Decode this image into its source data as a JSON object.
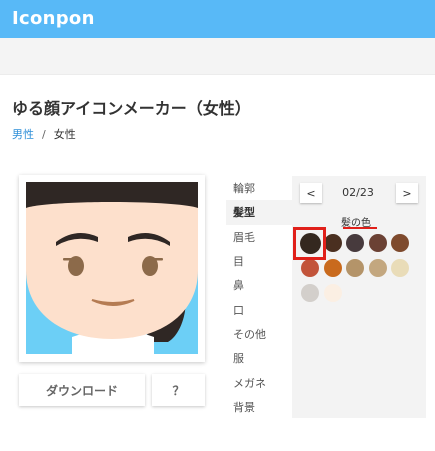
{
  "app": {
    "logo": "Iconpon"
  },
  "page": {
    "title": "ゆる顔アイコンメーカー（女性）"
  },
  "gender": {
    "male": "男性",
    "separator": "/",
    "female": "女性"
  },
  "preview": {
    "colors": {
      "background": "#6ccff6",
      "skin": "#fde0cc",
      "hair": "#2f2724",
      "eyes": "#8c6a4a",
      "mouth": "#b57c53",
      "shirt": "#ffffff"
    }
  },
  "buttons": {
    "download": "ダウンロード",
    "help": "？"
  },
  "categories": [
    "輪郭",
    "髪型",
    "眉毛",
    "目",
    "鼻",
    "口",
    "その他",
    "服",
    "メガネ",
    "背景"
  ],
  "active_category": "髪型",
  "pager": {
    "prev": "<",
    "next": ">",
    "current": "02/23"
  },
  "part_label": "髪の色",
  "swatches": [
    "#34281f",
    "#4a2f20",
    "#473a3d",
    "#6b4134",
    "#7e4a2d",
    "#c2543a",
    "#c96a1d",
    "#b49469",
    "#c3a77f",
    "#e9dcb8",
    "#d3cfcb",
    "#fbefe3"
  ],
  "selected_swatch": 0
}
